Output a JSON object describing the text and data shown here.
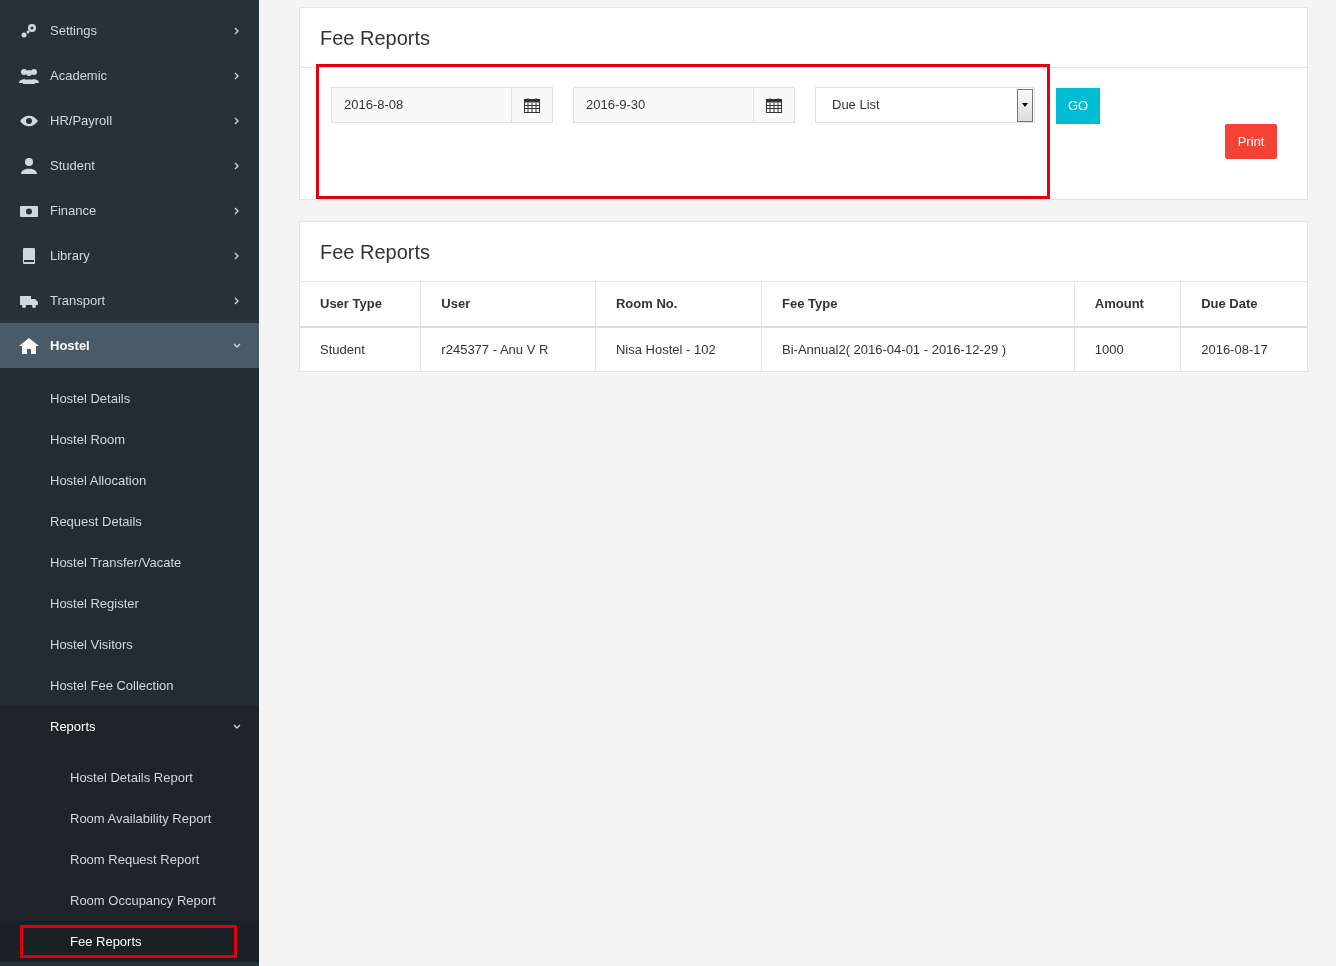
{
  "sidebar": {
    "items": [
      {
        "label": "Settings",
        "expanded": false,
        "selected": false
      },
      {
        "label": "Academic",
        "expanded": false,
        "selected": false
      },
      {
        "label": "HR/Payroll",
        "expanded": false,
        "selected": false
      },
      {
        "label": "Student",
        "expanded": false,
        "selected": false
      },
      {
        "label": "Finance",
        "expanded": false,
        "selected": false
      },
      {
        "label": "Library",
        "expanded": false,
        "selected": false
      },
      {
        "label": "Transport",
        "expanded": false,
        "selected": false
      },
      {
        "label": "Hostel",
        "expanded": true,
        "selected": true,
        "children": [
          {
            "label": "Hostel Details",
            "selected": false
          },
          {
            "label": "Hostel Room",
            "selected": false
          },
          {
            "label": "Hostel Allocation",
            "selected": false
          },
          {
            "label": "Request Details",
            "selected": false
          },
          {
            "label": "Hostel Transfer/Vacate",
            "selected": false
          },
          {
            "label": "Hostel Register",
            "selected": false
          },
          {
            "label": "Hostel Visitors",
            "selected": false
          },
          {
            "label": "Hostel Fee Collection",
            "selected": false
          },
          {
            "label": "Reports",
            "expanded": true,
            "selected": false,
            "children": [
              {
                "label": "Hostel Details Report",
                "selected": false,
                "highlighted": false
              },
              {
                "label": "Room Availability Report",
                "selected": false,
                "highlighted": false
              },
              {
                "label": "Room Request Report",
                "selected": false,
                "highlighted": false
              },
              {
                "label": "Room Occupancy Report",
                "selected": false,
                "highlighted": false
              },
              {
                "label": "Fee Reports",
                "selected": true,
                "highlighted": true
              }
            ]
          }
        ]
      }
    ]
  },
  "filter_card": {
    "title": "Fee Reports",
    "highlighted": true,
    "from_date": "2016-8-08",
    "to_date": "2016-9-30",
    "report_type": "Due List",
    "go_button": "GO",
    "print_button": "Print"
  },
  "table_card": {
    "title": "Fee Reports",
    "columns": [
      "User Type",
      "User",
      "Room No.",
      "Fee Type",
      "Amount",
      "Due Date"
    ],
    "rows": [
      [
        "Student",
        "r245377 - Anu V R",
        "Nisa Hostel - 102",
        "Bi-Annual2( 2016-04-01 - 2016-12-29 )",
        "1000",
        "2016-08-17"
      ]
    ]
  }
}
